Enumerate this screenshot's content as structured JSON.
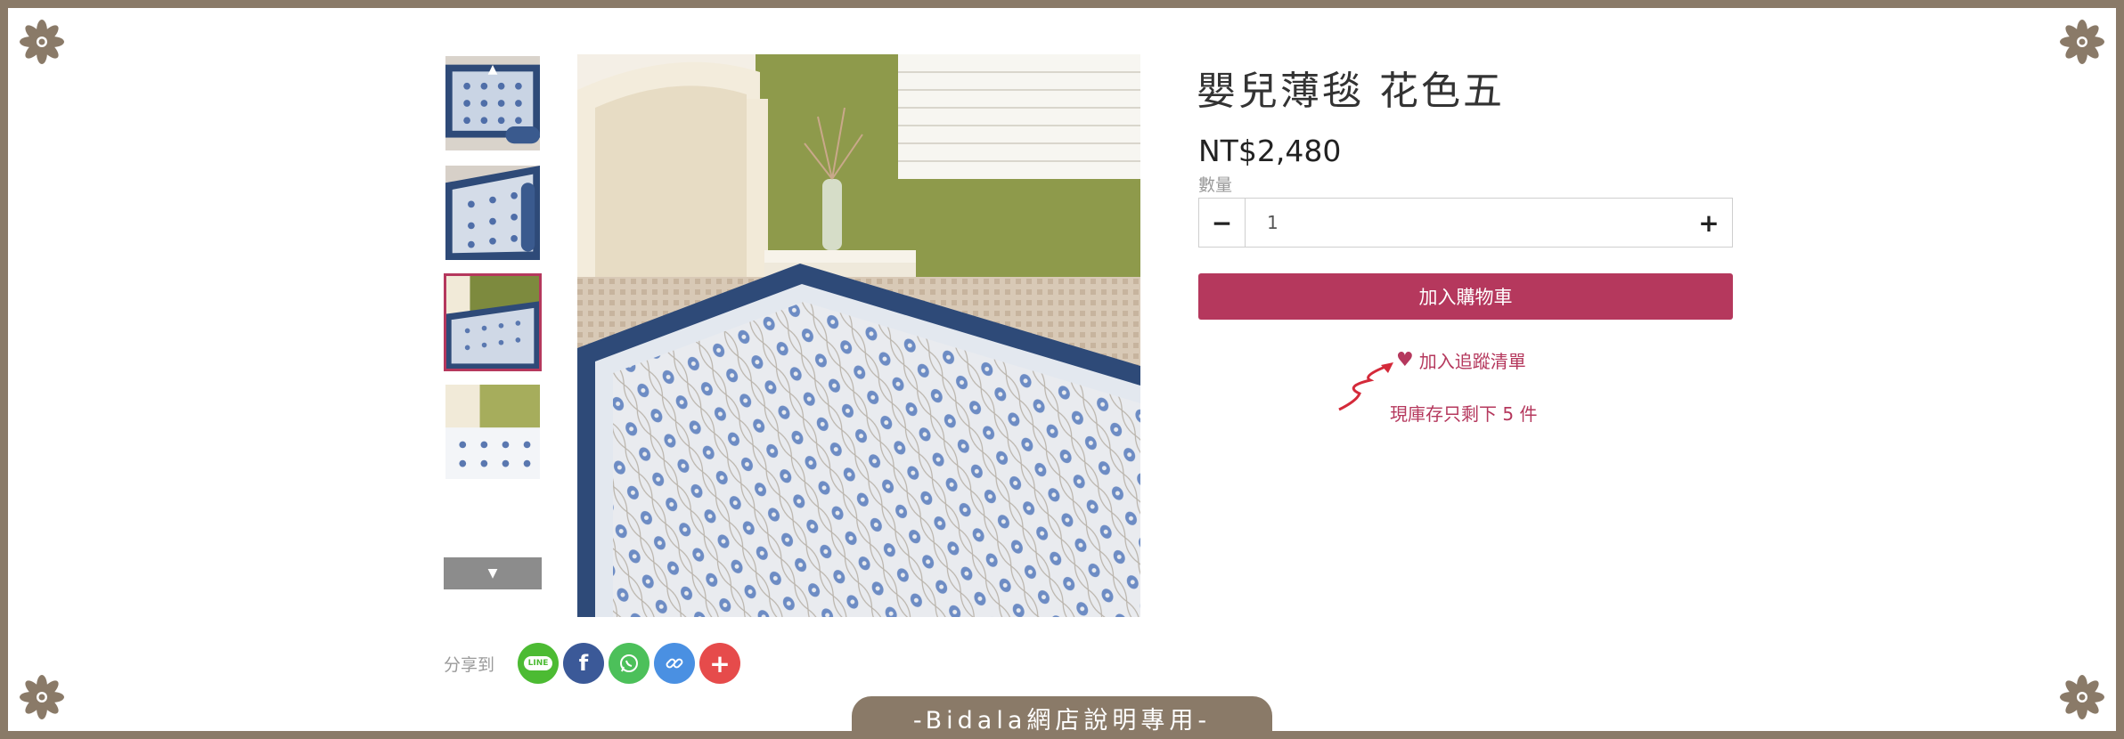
{
  "product": {
    "title": "嬰兒薄毯 花色五",
    "price": "NT$2,480",
    "quantity_label": "數量",
    "quantity_value": "1",
    "add_to_cart_label": "加入購物車",
    "wishlist_label": "加入追蹤清單",
    "stock_text": "現庫存只剩下 5 件"
  },
  "share": {
    "label": "分享到",
    "buttons": [
      {
        "name": "line",
        "text": "LINE",
        "color": "#4cbb33"
      },
      {
        "name": "facebook",
        "text": "f",
        "color": "#3b5998"
      },
      {
        "name": "whatsapp",
        "color": "#4cc05a"
      },
      {
        "name": "copy-link",
        "color": "#4a90e2"
      },
      {
        "name": "more",
        "text": "+",
        "color": "#e64b4b"
      }
    ]
  },
  "gallery": {
    "thumbnail_count": 4,
    "active_thumbnail_index": 2
  },
  "footer_tab": "-Bidala網店說明專用-",
  "icons": {
    "minus": "−",
    "plus": "+",
    "heart": "♥",
    "thumb_up": "▲",
    "thumb_down": "▼"
  },
  "colors": {
    "accent": "#b5385d",
    "frame": "#8a7a68",
    "background": "#ffffff"
  }
}
